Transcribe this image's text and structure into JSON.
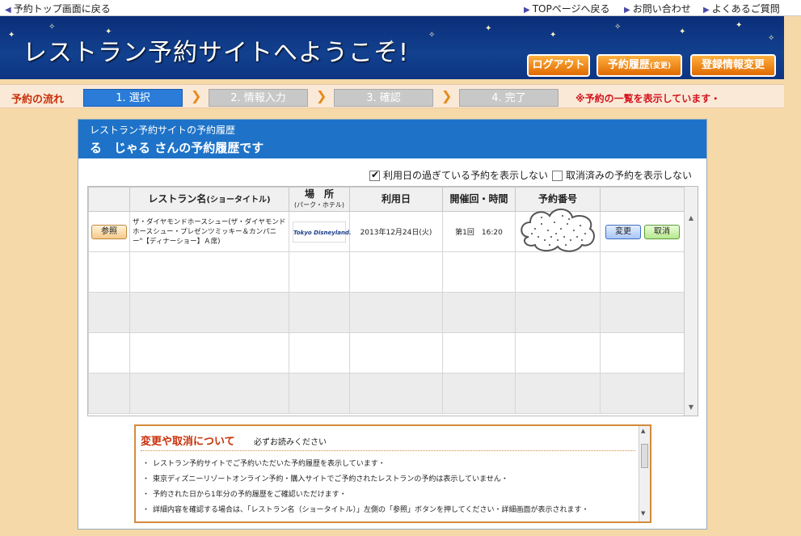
{
  "topbar": {
    "back_link": "予約トップ画面に戻る",
    "top_link": "TOPページへ戻る",
    "contact_link": "お問い合わせ",
    "faq_link": "よくあるご質問"
  },
  "header": {
    "title": "レストラン予約サイトへようこそ!",
    "logout": "ログアウト",
    "history": "予約履歴",
    "history_small": "(変更)",
    "register": "登録情報変更"
  },
  "flow": {
    "label": "予約の流れ",
    "steps": [
      "1. 選択",
      "2. 情報入力",
      "3. 確認",
      "4. 完了"
    ],
    "active_step": 1,
    "note": "※予約の一覧を表示しています・"
  },
  "panel": {
    "subtitle": "レストラン予約サイトの予約履歴",
    "title": "る　じゃる さんの予約履歴です"
  },
  "filters": {
    "show_past": "利用日の過ぎている予約を表示しない",
    "show_past_checked": true,
    "show_cancelled": "取消済みの予約を表示しない",
    "show_cancelled_checked": false
  },
  "table": {
    "headers": {
      "restaurant": "レストラン名",
      "restaurant_small": "(ショータイトル)",
      "place": "場　所",
      "place_small": "(パーク・ホテル)",
      "date": "利用日",
      "session": "開催回・時間",
      "number": "予約番号"
    },
    "rows": [
      {
        "ref_button": "参照",
        "restaurant": "ザ・ダイヤモンドホースシュー(ザ・ダイヤモンドホースシュー・プレゼンツミッキー＆カンパニー\"【ディナーショー】Ａ席)",
        "place_logo": "Tokyo Disneyland.",
        "date": "2013年12月24日(火)",
        "session": "第1回　16:20",
        "change_button": "変更",
        "cancel_button": "取消"
      }
    ]
  },
  "notice": {
    "title": "変更や取消について",
    "subtitle": "必ずお読みください",
    "items": [
      "レストラン予約サイトでご予約いただいた予約履歴を表示しています・",
      "東京ディズニーリゾートオンライン予約・購入サイトでご予約されたレストランの予約は表示していません・",
      "予約された日から1年分の予約履歴をご確認いただけます・",
      "詳細内容を確認する場合は、「レストラン名（ショータイトル）」左側の「参照」ボタンを押してください・詳細画面が表示されます・"
    ]
  }
}
